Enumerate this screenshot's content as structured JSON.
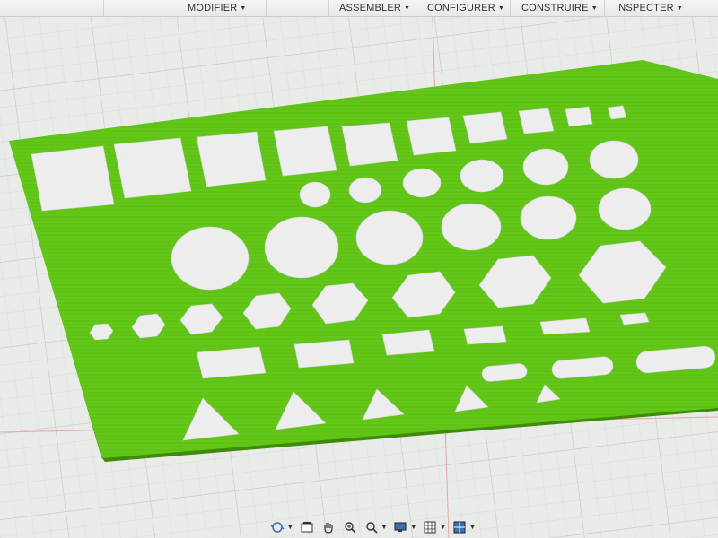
{
  "toolbar": {
    "modify_label": "MODIFIER",
    "assemble_label": "ASSEMBLER",
    "configure_label": "CONFIGURER",
    "construct_label": "CONSTRUIRE",
    "inspect_label": "INSPECTER"
  },
  "canvas": {
    "plate_color": "#62c716",
    "plate_edge_color": "#3f8a0c",
    "cutout_color": "#ecedec",
    "grid_line_color": "#c6c9c6",
    "origin_axis_color": "#dfa2a2",
    "cutout_rows": [
      {
        "shape": "square",
        "count": 10
      },
      {
        "shape": "small-circle",
        "count": 6
      },
      {
        "shape": "circle",
        "count": 6
      },
      {
        "shape": "hexagon",
        "count": 9
      },
      {
        "shape": "rectangle",
        "count": 5
      },
      {
        "shape": "slot",
        "count": 3
      },
      {
        "shape": "triangle",
        "count": 5
      }
    ]
  },
  "navigation_bar": {
    "items": [
      "orbit-icon",
      "look-at-icon",
      "pan-icon",
      "zoom-icon",
      "fit-icon",
      "display-mode-icon",
      "grid-icon",
      "viewports-icon"
    ]
  }
}
